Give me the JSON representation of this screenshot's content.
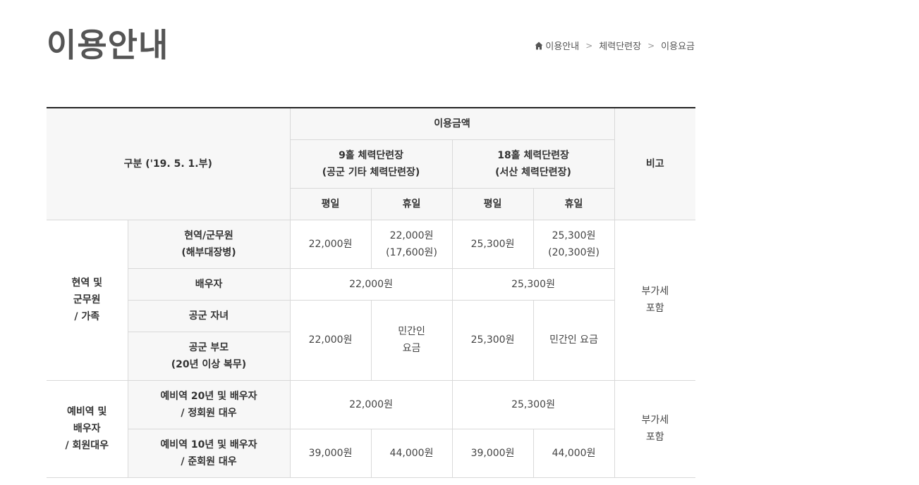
{
  "page": {
    "title": "이용안내"
  },
  "breadcrumb": {
    "items": [
      "이용안내",
      "체력단련장",
      "이용요금"
    ],
    "home_icon": "home-icon"
  },
  "table": {
    "header": {
      "category": "구분 ('19. 5. 1.부)",
      "amount": "이용금액",
      "note": "비고",
      "venue9_line1": "9홀 체력단련장",
      "venue9_line2": "(공군 기타 체력단련장)",
      "venue18_line1": "18홀 체력단련장",
      "venue18_line2": "(서산 체력단련장)",
      "weekday": "평일",
      "holiday": "휴일"
    },
    "group1": {
      "label_line1": "현역 및",
      "label_line2": "군무원",
      "label_line3": "/ 가족",
      "note_line1": "부가세",
      "note_line2": "포함",
      "rows": {
        "active_line1": "현역/군무원",
        "active_line2": "(해부대장병)",
        "active_9_weekday": "22,000원",
        "active_9_holiday_line1": "22,000원",
        "active_9_holiday_line2": "(17,600원)",
        "active_18_weekday": "25,300원",
        "active_18_holiday_line1": "25,300원",
        "active_18_holiday_line2": "(20,300원)",
        "spouse": "배우자",
        "spouse_9": "22,000원",
        "spouse_18": "25,300원",
        "children": "공군 자녀",
        "parents_line1": "공군 부모",
        "parents_line2": "(20년 이상 복무)",
        "family_9_weekday": "22,000원",
        "family_9_holiday_line1": "민간인",
        "family_9_holiday_line2": "요금",
        "family_18_weekday": "25,300원",
        "family_18_holiday": "민간인 요금"
      }
    },
    "group2": {
      "label_line1": "예비역 및",
      "label_line2": "배우자",
      "label_line3": "/ 회원대우",
      "note_line1": "부가세",
      "note_line2": "포함",
      "rows": {
        "reserve20_line1": "예비역 20년 및 배우자",
        "reserve20_line2": "/ 정회원 대우",
        "reserve20_9": "22,000원",
        "reserve20_18": "25,300원",
        "reserve10_line1": "예비역 10년 및 배우자",
        "reserve10_line2": "/ 준회원 대우",
        "reserve10_9_weekday": "39,000원",
        "reserve10_9_holiday": "44,000원",
        "reserve10_18_weekday": "39,000원",
        "reserve10_18_holiday": "44,000원"
      }
    }
  }
}
